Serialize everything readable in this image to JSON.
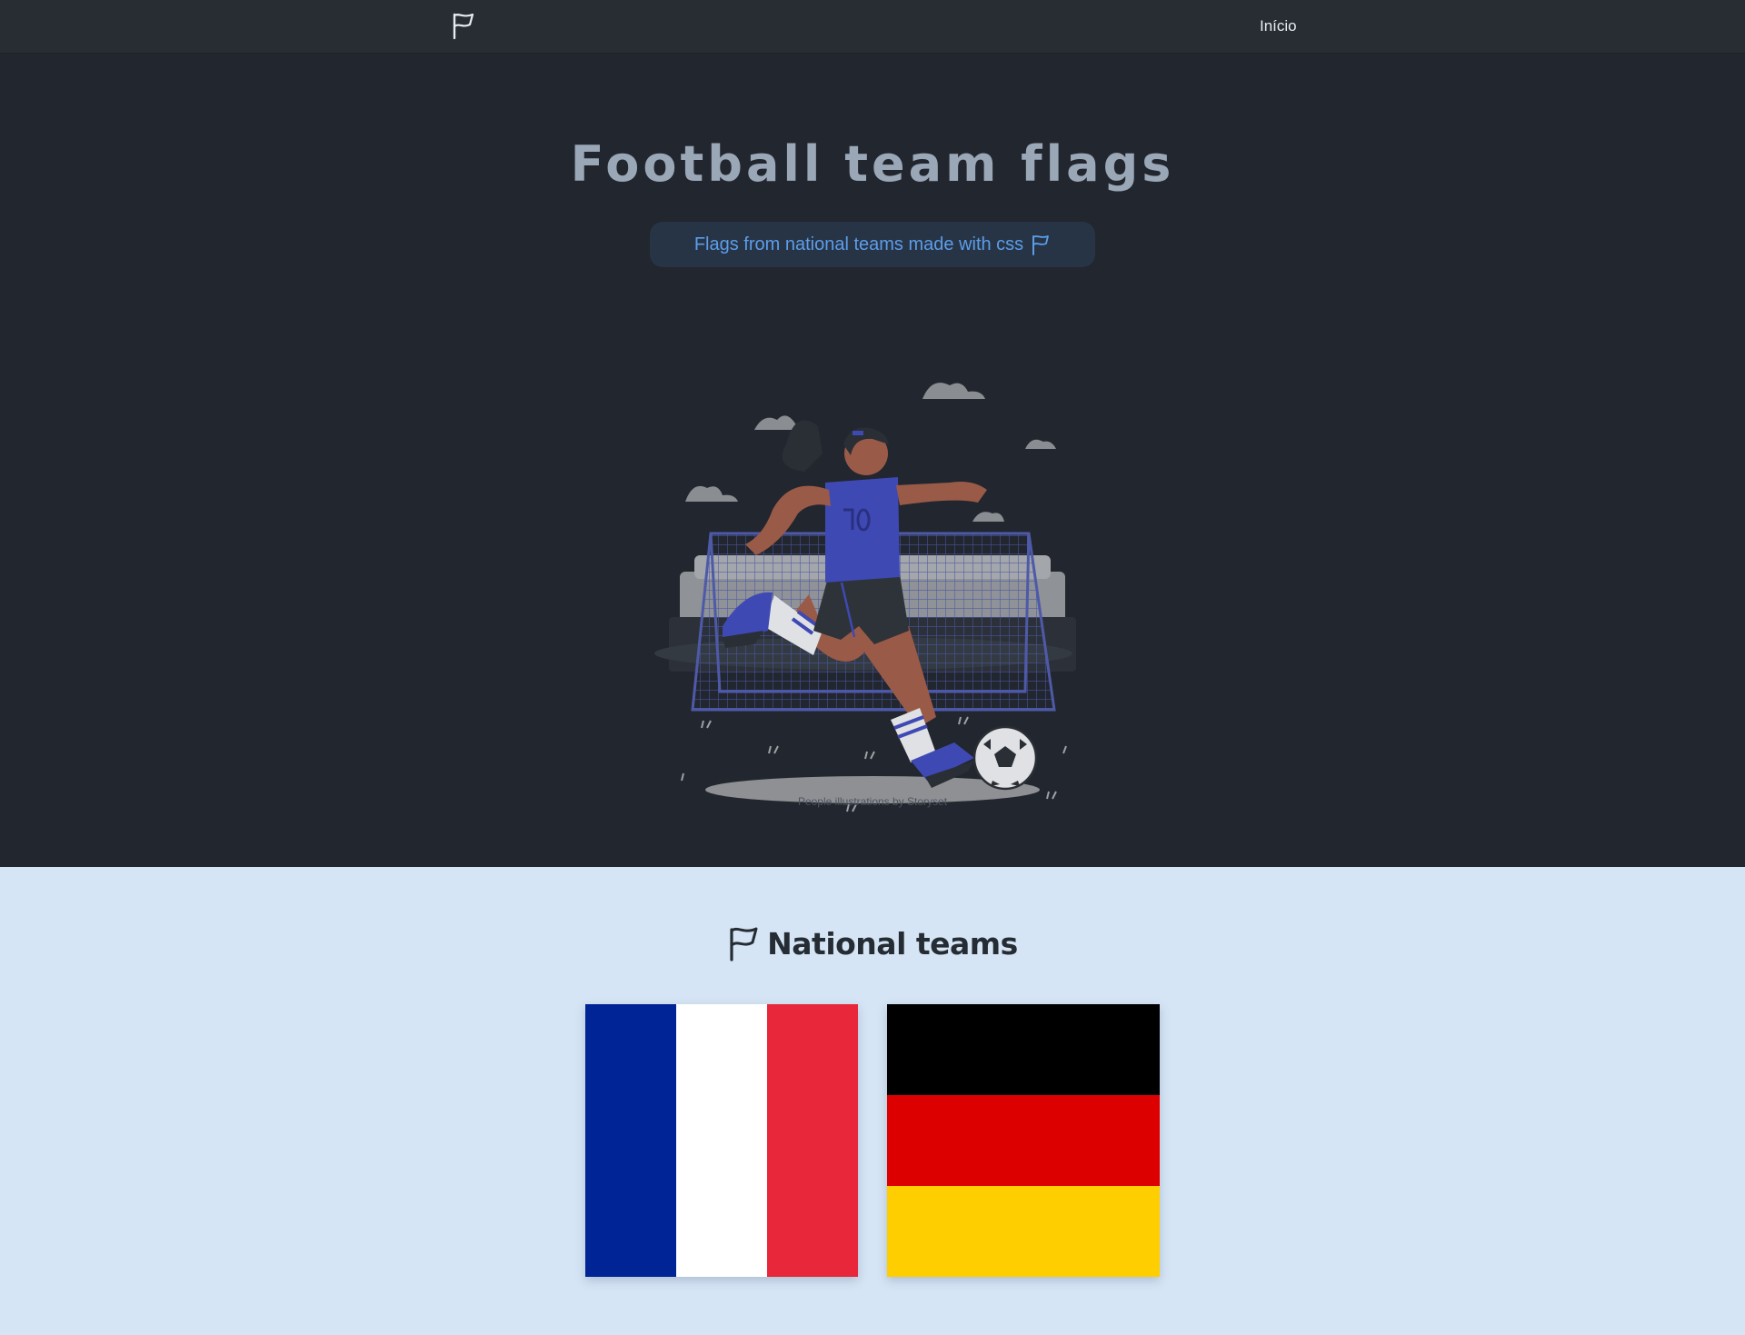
{
  "nav": {
    "logo_icon": "flag-icon",
    "home_link": "Início"
  },
  "hero": {
    "title": "Football team flags",
    "subtitle": "Flags from national teams made with css",
    "subtitle_icon": "flag-icon",
    "illustration": "woman soccer player kicking ball in front of goal",
    "credit": "People illustrations by Storyset"
  },
  "teams": {
    "heading_icon": "flag-icon",
    "heading": "National teams",
    "flags": [
      {
        "country": "France",
        "colors": [
          "#002395",
          "#ffffff",
          "#e8283a"
        ]
      },
      {
        "country": "Germany",
        "colors": [
          "#000000",
          "#dd0000",
          "#ffce00"
        ]
      }
    ]
  },
  "colors": {
    "nav_bg": "#282d34",
    "hero_bg": "#22262e",
    "accent": "#5d9de8",
    "teams_bg": "#d5e5f5"
  }
}
